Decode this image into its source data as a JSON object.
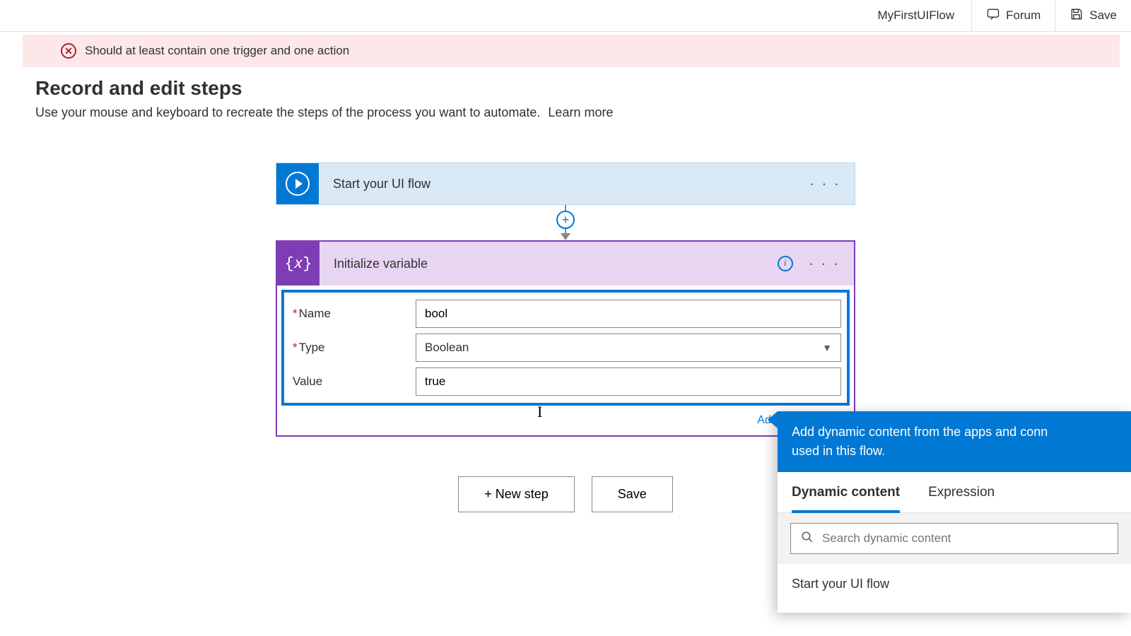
{
  "topbar": {
    "flow_name": "MyFirstUIFlow",
    "forum_label": "Forum",
    "save_label": "Save"
  },
  "error": {
    "message": "Should at least contain one trigger and one action"
  },
  "header": {
    "title": "Record and edit steps",
    "subtitle": "Use your mouse and keyboard to recreate the steps of the process you want to automate.",
    "learn_more": "Learn more"
  },
  "steps": {
    "start_title": "Start your UI flow",
    "init_var_title": "Initialize variable",
    "fields": {
      "name_label": "Name",
      "name_value": "bool",
      "type_label": "Type",
      "type_value": "Boolean",
      "value_label": "Value",
      "value_value": "true"
    },
    "add_dynamic": "Add dynamic con"
  },
  "footer": {
    "new_step": "+ New step",
    "save": "Save"
  },
  "flyout": {
    "header": "Add dynamic content from the apps and conne used in this flow.",
    "header_l1": "Add dynamic content from the apps and conn",
    "header_l2": "used in this flow.",
    "tab_dynamic": "Dynamic content",
    "tab_expression": "Expression",
    "search_placeholder": "Search dynamic content",
    "section_title": "Start your UI flow"
  }
}
